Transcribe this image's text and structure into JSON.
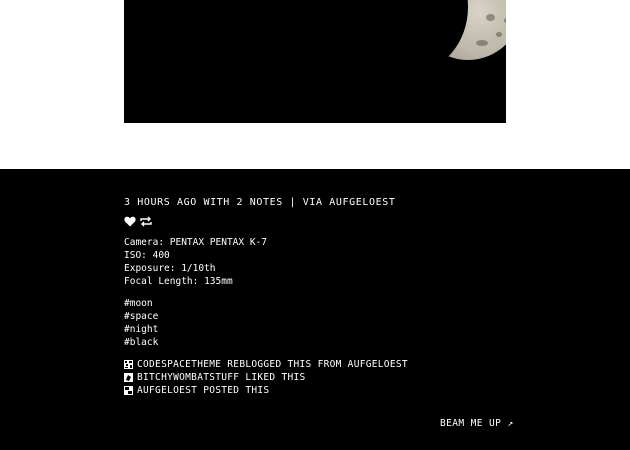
{
  "post": {
    "meta": {
      "time_notes": "3 HOURS AGO WITH 2 NOTES",
      "separator": "|",
      "via": "VIA AUFGELOEST"
    },
    "icons": {
      "like": "heart-icon",
      "reblog": "reblog-icon"
    },
    "exif": [
      "Camera: PENTAX PENTAX K-7",
      "ISO: 400",
      "Exposure: 1/10th",
      "Focal Length: 135mm"
    ],
    "tags": [
      "#moon",
      "#space",
      "#night",
      "#black"
    ],
    "notes": [
      "CODESPACETHEME REBLOGGED THIS FROM AUFGELOEST",
      "BITCHYWOMBATSTUFF LIKED THIS",
      "AUFGELOEST POSTED THIS"
    ]
  },
  "footer": {
    "beam_label": "BEAM ME UP",
    "beam_icon": "↗"
  },
  "colors": {
    "background": "#000000",
    "text": "#ffffff",
    "page": "#ffffff"
  }
}
